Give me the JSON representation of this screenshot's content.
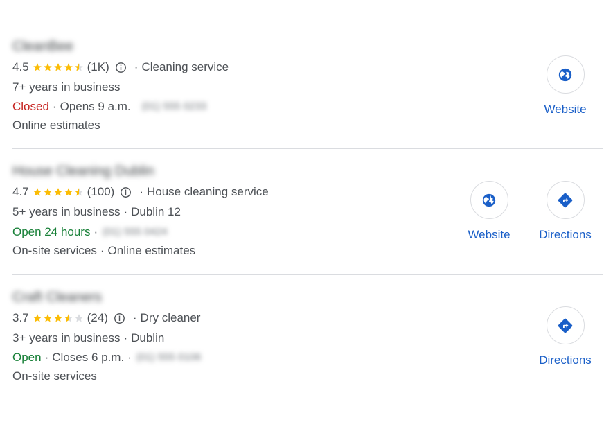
{
  "listings": [
    {
      "name": "CleanBee",
      "rating": "4.5",
      "stars": [
        1,
        1,
        1,
        1,
        0.5
      ],
      "review_count": "(1K)",
      "category": "Cleaning service",
      "years": "7+ years in business",
      "location": "",
      "status": "Closed",
      "status_detail": "Opens 9 a.m.",
      "phone": "(01) 555 0233",
      "services": [
        "Online estimates"
      ],
      "actions": [
        "Website"
      ]
    },
    {
      "name": "House Cleaning Dublin",
      "rating": "4.7",
      "stars": [
        1,
        1,
        1,
        1,
        0.5
      ],
      "review_count": "(100)",
      "category": "House cleaning service",
      "years": "5+ years in business",
      "location": "Dublin 12",
      "status": "Open 24 hours",
      "status_detail": "",
      "phone": "(01) 555 0424",
      "services": [
        "On-site services",
        "Online estimates"
      ],
      "actions": [
        "Website",
        "Directions"
      ]
    },
    {
      "name": "Craft Cleaners",
      "rating": "3.7",
      "stars": [
        1,
        1,
        1,
        0.5,
        0
      ],
      "review_count": "(24)",
      "category": "Dry cleaner",
      "years": "3+ years in business",
      "location": "Dublin",
      "status": "Open",
      "status_detail": "Closes 6 p.m.",
      "phone": "(01) 555 0106",
      "services": [
        "On-site services"
      ],
      "actions": [
        "Directions"
      ]
    }
  ],
  "separator": "·",
  "colors": {
    "star": "#fbbc04",
    "star_empty": "#dadce0",
    "closed": "#c5221f",
    "open": "#188038",
    "link": "#1a5fc8",
    "icon": "#1a5fc8"
  },
  "icons": {
    "website": "globe-icon",
    "directions": "directions-icon",
    "info": "info-icon"
  }
}
